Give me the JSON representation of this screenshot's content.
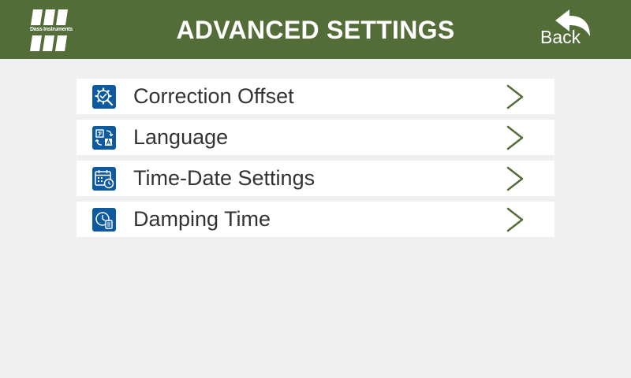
{
  "header": {
    "brand_text": "Dass Instruments",
    "title": "ADVANCED SETTINGS",
    "back_label": "Back"
  },
  "menu": {
    "items": [
      {
        "label": "Correction Offset",
        "icon": "gear-check-icon"
      },
      {
        "label": "Language",
        "icon": "translate-icon"
      },
      {
        "label": "Time-Date Settings",
        "icon": "calendar-clock-icon"
      },
      {
        "label": "Damping Time",
        "icon": "clock-document-icon"
      }
    ]
  },
  "colors": {
    "header_bg": "#536d38",
    "page_bg": "#f0f0f0",
    "icon_bg": "#0e5aa0",
    "chevron": "#536d38",
    "text": "#333333"
  }
}
